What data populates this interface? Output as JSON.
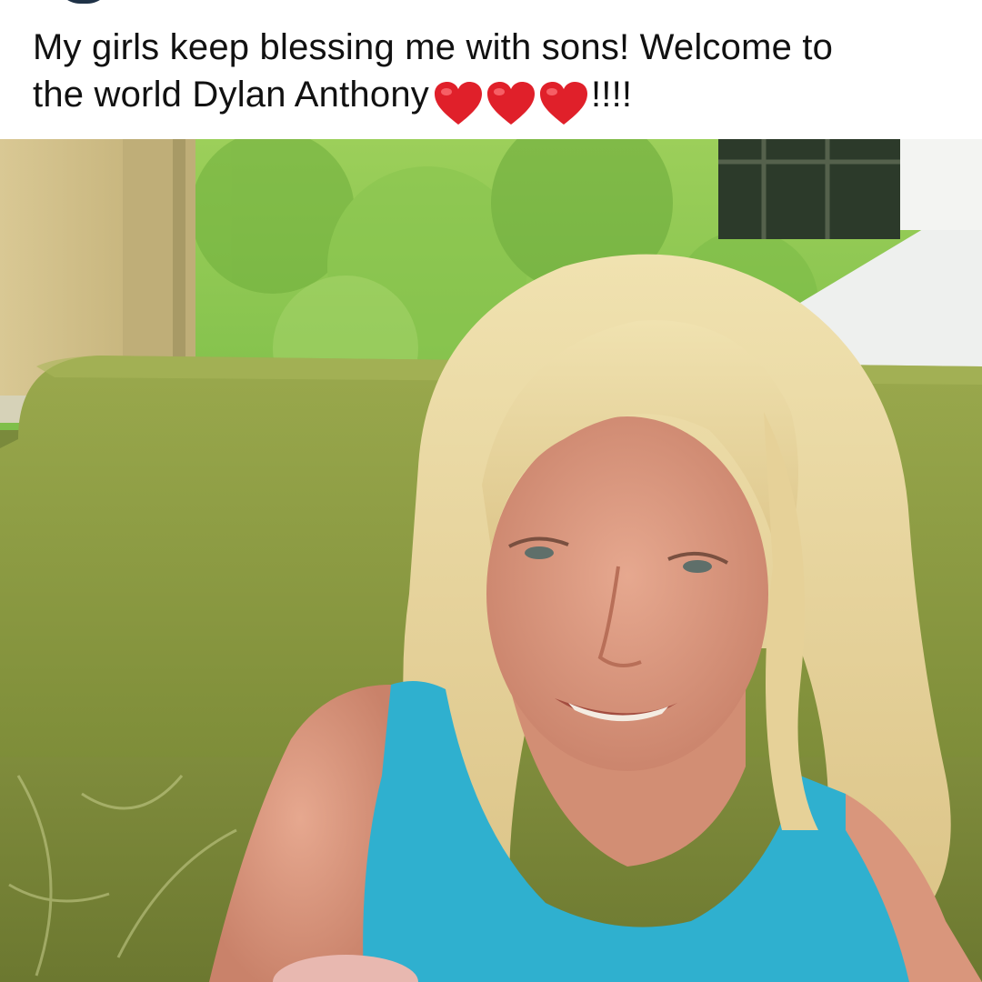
{
  "post": {
    "caption_line1": "My girls keep blessing me with sons!  Welcome to",
    "caption_line2": "the world Dylan Anthony",
    "caption_suffix": "!!!!",
    "hearts": [
      "red-heart-icon",
      "red-heart-icon",
      "red-heart-icon"
    ],
    "heart_color": "#e0202a"
  },
  "colors": {
    "text": "#111111",
    "background": "#ffffff",
    "booth_green": "#8f9e45",
    "tank_top": "#2fb0cf",
    "hair": "#e8d49a"
  }
}
